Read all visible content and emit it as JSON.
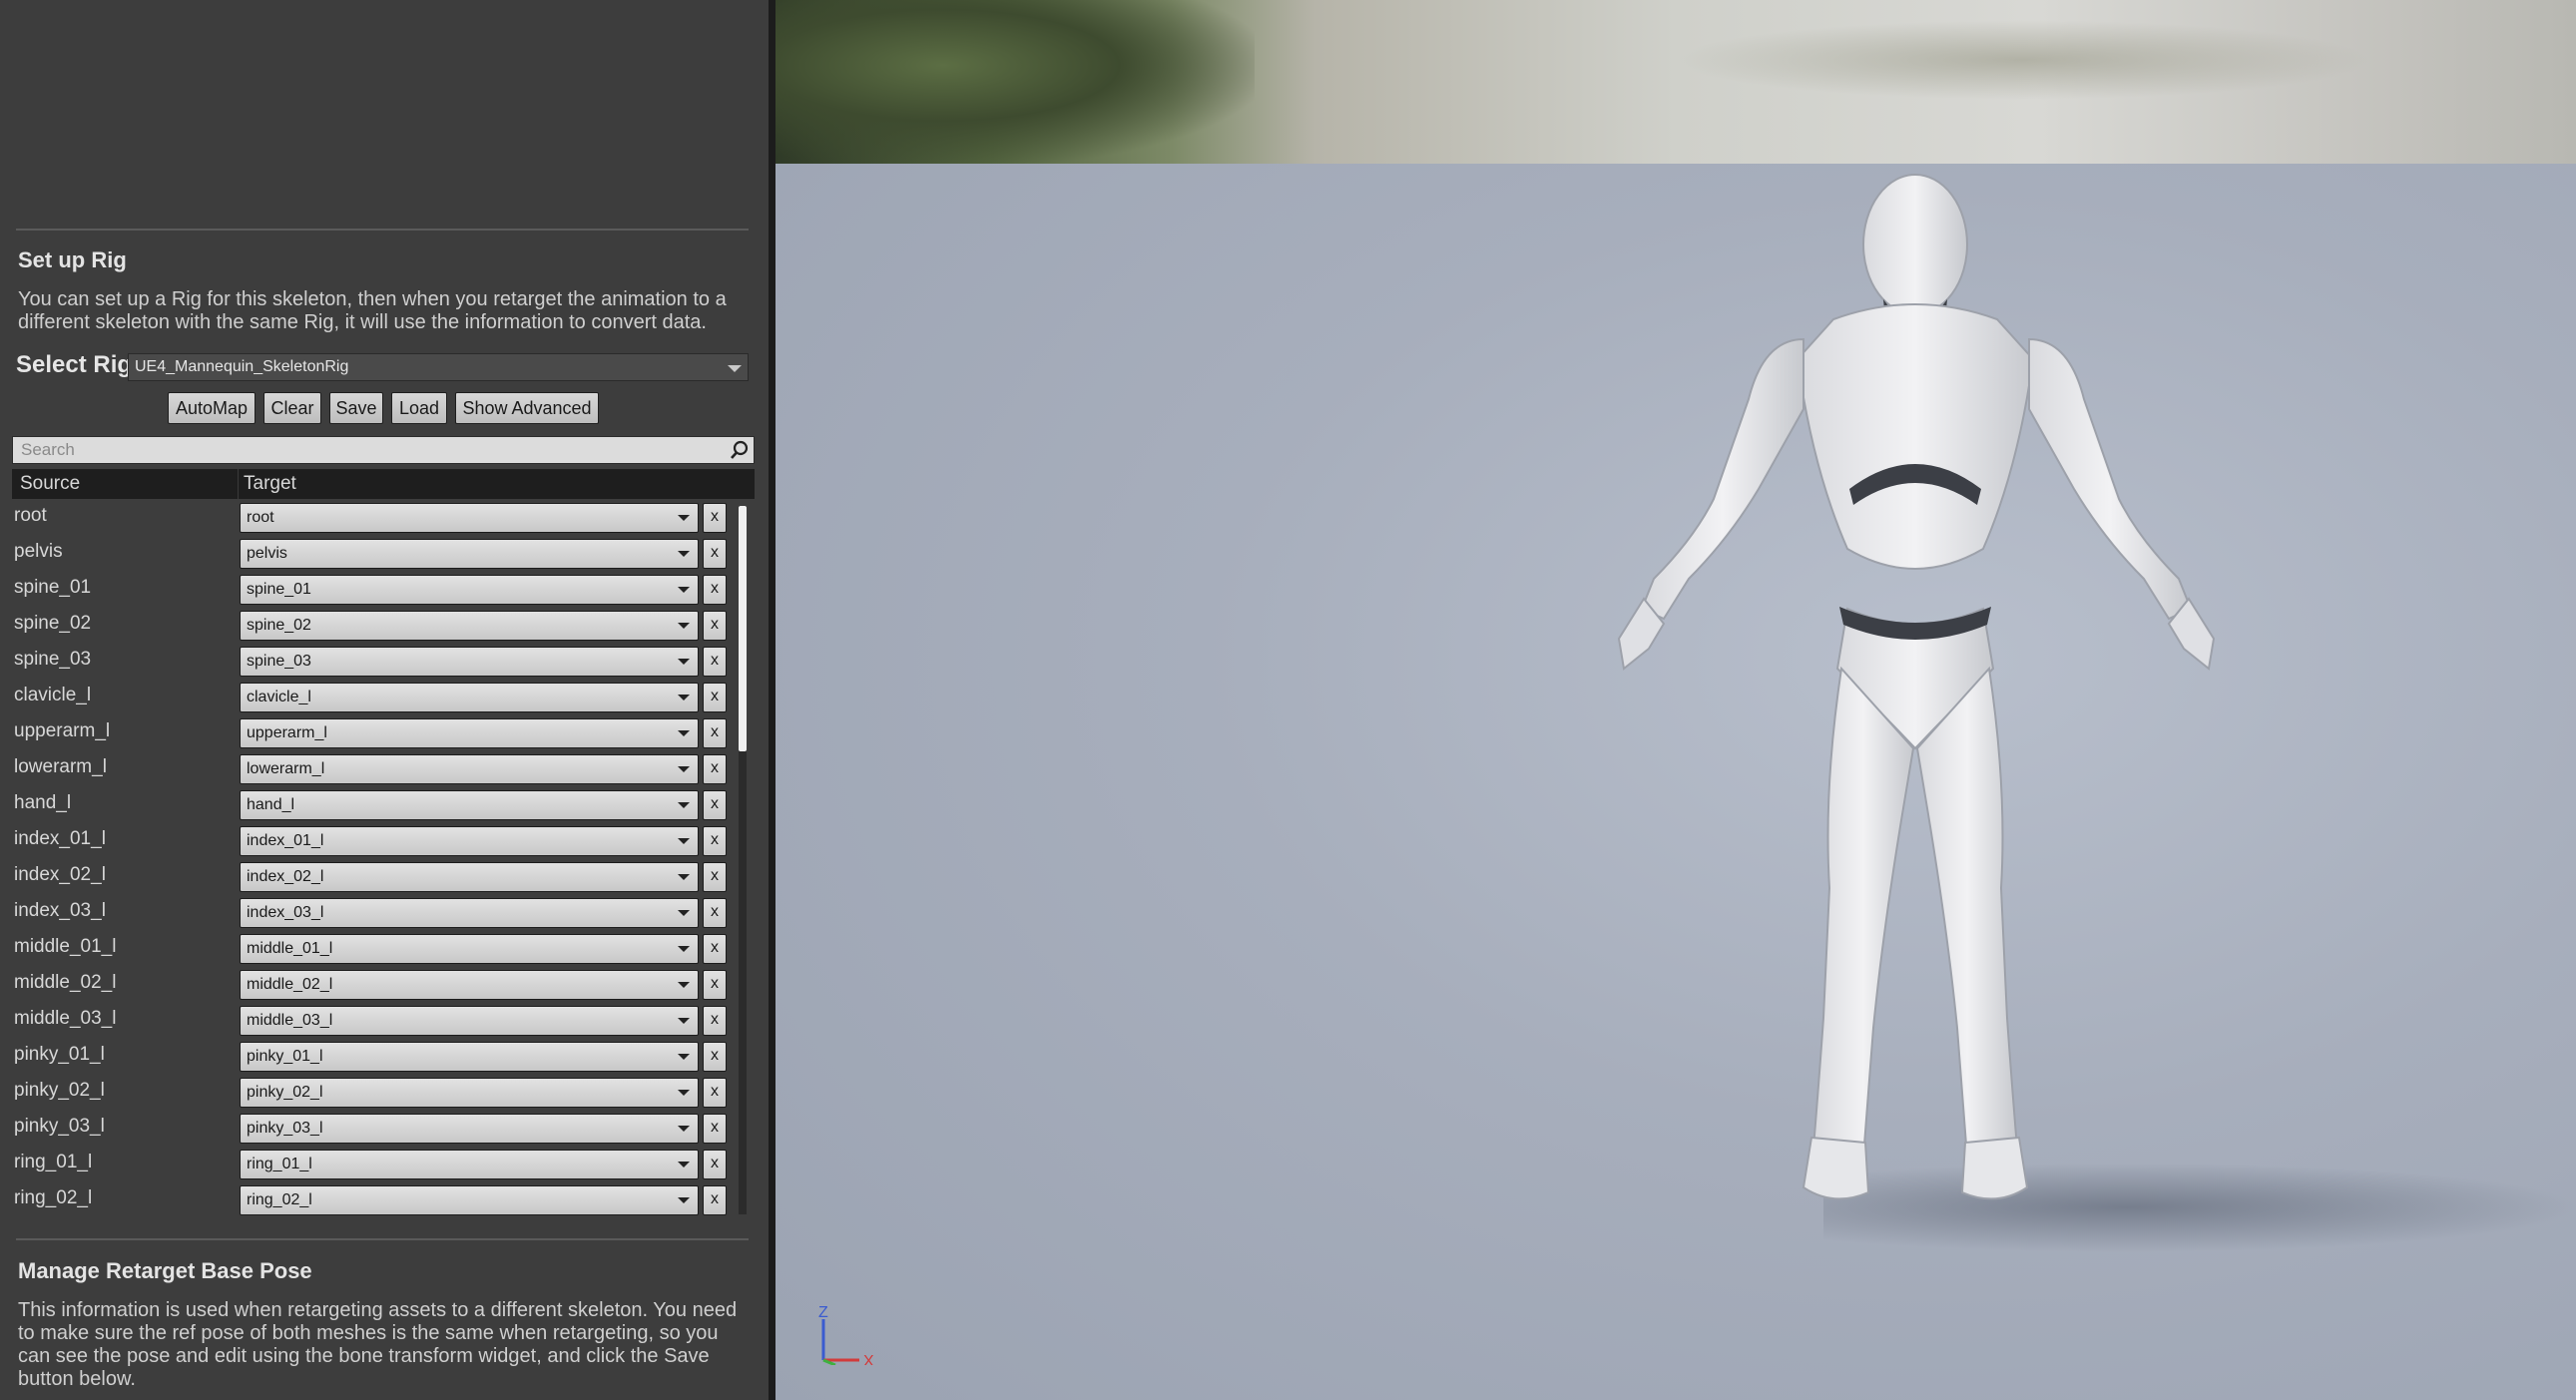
{
  "setup_rig": {
    "title": "Set up Rig",
    "description": "You can set up a Rig for this skeleton, then when you retarget the animation to a different skeleton with the same Rig, it will use the information to convert data.",
    "select_rig_label": "Select Rig",
    "selected_rig": "UE4_Mannequin_SkeletonRig"
  },
  "buttons": {
    "automap": "AutoMap",
    "clear": "Clear",
    "save": "Save",
    "load": "Load",
    "show_advanced": "Show Advanced"
  },
  "search": {
    "placeholder": "Search"
  },
  "table": {
    "source_header": "Source",
    "target_header": "Target",
    "remove_label": "x",
    "rows": [
      {
        "source": "root",
        "target": "root"
      },
      {
        "source": "pelvis",
        "target": "pelvis"
      },
      {
        "source": "spine_01",
        "target": "spine_01"
      },
      {
        "source": "spine_02",
        "target": "spine_02"
      },
      {
        "source": "spine_03",
        "target": "spine_03"
      },
      {
        "source": "clavicle_l",
        "target": "clavicle_l"
      },
      {
        "source": "upperarm_l",
        "target": "upperarm_l"
      },
      {
        "source": "lowerarm_l",
        "target": "lowerarm_l"
      },
      {
        "source": "hand_l",
        "target": "hand_l"
      },
      {
        "source": "index_01_l",
        "target": "index_01_l"
      },
      {
        "source": "index_02_l",
        "target": "index_02_l"
      },
      {
        "source": "index_03_l",
        "target": "index_03_l"
      },
      {
        "source": "middle_01_l",
        "target": "middle_01_l"
      },
      {
        "source": "middle_02_l",
        "target": "middle_02_l"
      },
      {
        "source": "middle_03_l",
        "target": "middle_03_l"
      },
      {
        "source": "pinky_01_l",
        "target": "pinky_01_l"
      },
      {
        "source": "pinky_02_l",
        "target": "pinky_02_l"
      },
      {
        "source": "pinky_03_l",
        "target": "pinky_03_l"
      },
      {
        "source": "ring_01_l",
        "target": "ring_01_l"
      },
      {
        "source": "ring_02_l",
        "target": "ring_02_l"
      }
    ]
  },
  "retarget_pose": {
    "title": "Manage Retarget Base Pose",
    "description": "This information is used when retargeting assets to a different skeleton. You need to make sure the ref pose of both meshes is the same when retargeting, so you can see the pose and edit using the bone transform widget, and click the Save button below."
  },
  "viewport": {
    "axis_z": "Z",
    "axis_x": "X"
  }
}
